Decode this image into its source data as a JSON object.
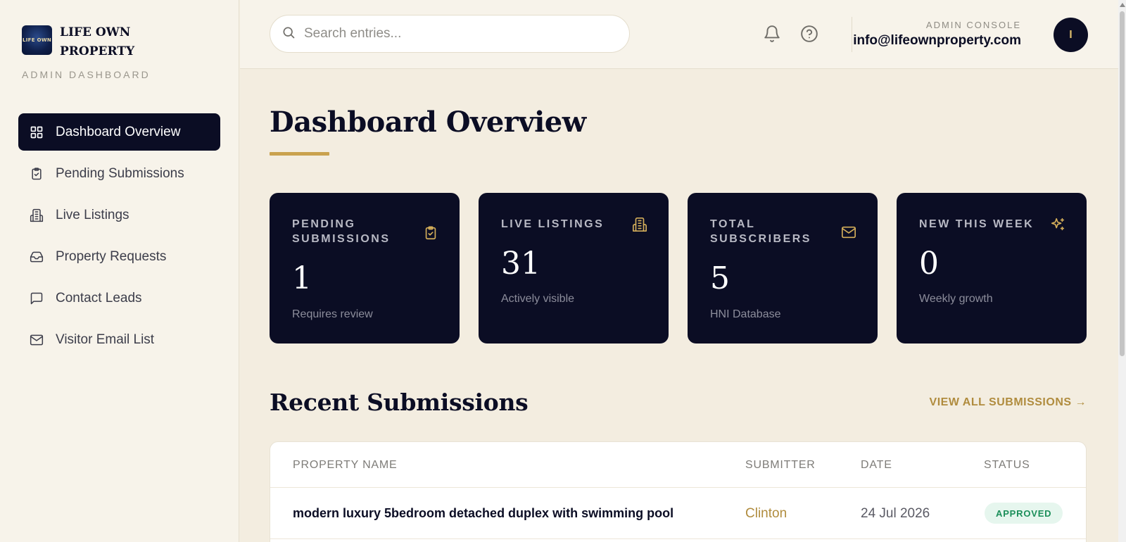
{
  "brand": {
    "logo_text": "LIFE OWN",
    "name": "LIFE OWN PROPERTY",
    "subtitle": "ADMIN DASHBOARD"
  },
  "sidebar": {
    "items": [
      {
        "label": "Dashboard Overview",
        "icon": "grid-icon",
        "active": true
      },
      {
        "label": "Pending Submissions",
        "icon": "clipboard-check-icon",
        "active": false
      },
      {
        "label": "Live Listings",
        "icon": "building-icon",
        "active": false
      },
      {
        "label": "Property Requests",
        "icon": "inbox-icon",
        "active": false
      },
      {
        "label": "Contact Leads",
        "icon": "message-square-icon",
        "active": false
      },
      {
        "label": "Visitor Email List",
        "icon": "mail-icon",
        "active": false
      }
    ]
  },
  "header": {
    "search_placeholder": "Search entries...",
    "search_value": "",
    "admin_label": "ADMIN CONSOLE",
    "admin_email": "info@lifeownproperty.com",
    "avatar_initial": "I"
  },
  "main": {
    "title": "Dashboard Overview",
    "stats": [
      {
        "label": "PENDING SUBMISSIONS",
        "value": "1",
        "sub": "Requires review",
        "icon": "clipboard-check-icon"
      },
      {
        "label": "LIVE LISTINGS",
        "value": "31",
        "sub": "Actively visible",
        "icon": "building-icon"
      },
      {
        "label": "TOTAL SUBSCRIBERS",
        "value": "5",
        "sub": "HNI Database",
        "icon": "mail-icon"
      },
      {
        "label": "NEW THIS WEEK",
        "value": "0",
        "sub": "Weekly growth",
        "icon": "sparkles-icon"
      }
    ],
    "recent": {
      "title": "Recent Submissions",
      "view_all": "VIEW ALL SUBMISSIONS →",
      "columns": [
        "PROPERTY NAME",
        "SUBMITTER",
        "DATE",
        "STATUS"
      ],
      "rows": [
        {
          "name": "modern luxury 5bedroom detached duplex with swimming pool",
          "submitter": "Clinton",
          "date": "24 Jul 2026",
          "status": "APPROVED"
        }
      ]
    }
  },
  "colors": {
    "navy": "#0b0d24",
    "gold": "#c9a24e",
    "gold_text": "#b08c3e",
    "cream": "#f3ede0",
    "status_approved_bg": "#e6f6ee",
    "status_approved_text": "#1c8f5a"
  }
}
